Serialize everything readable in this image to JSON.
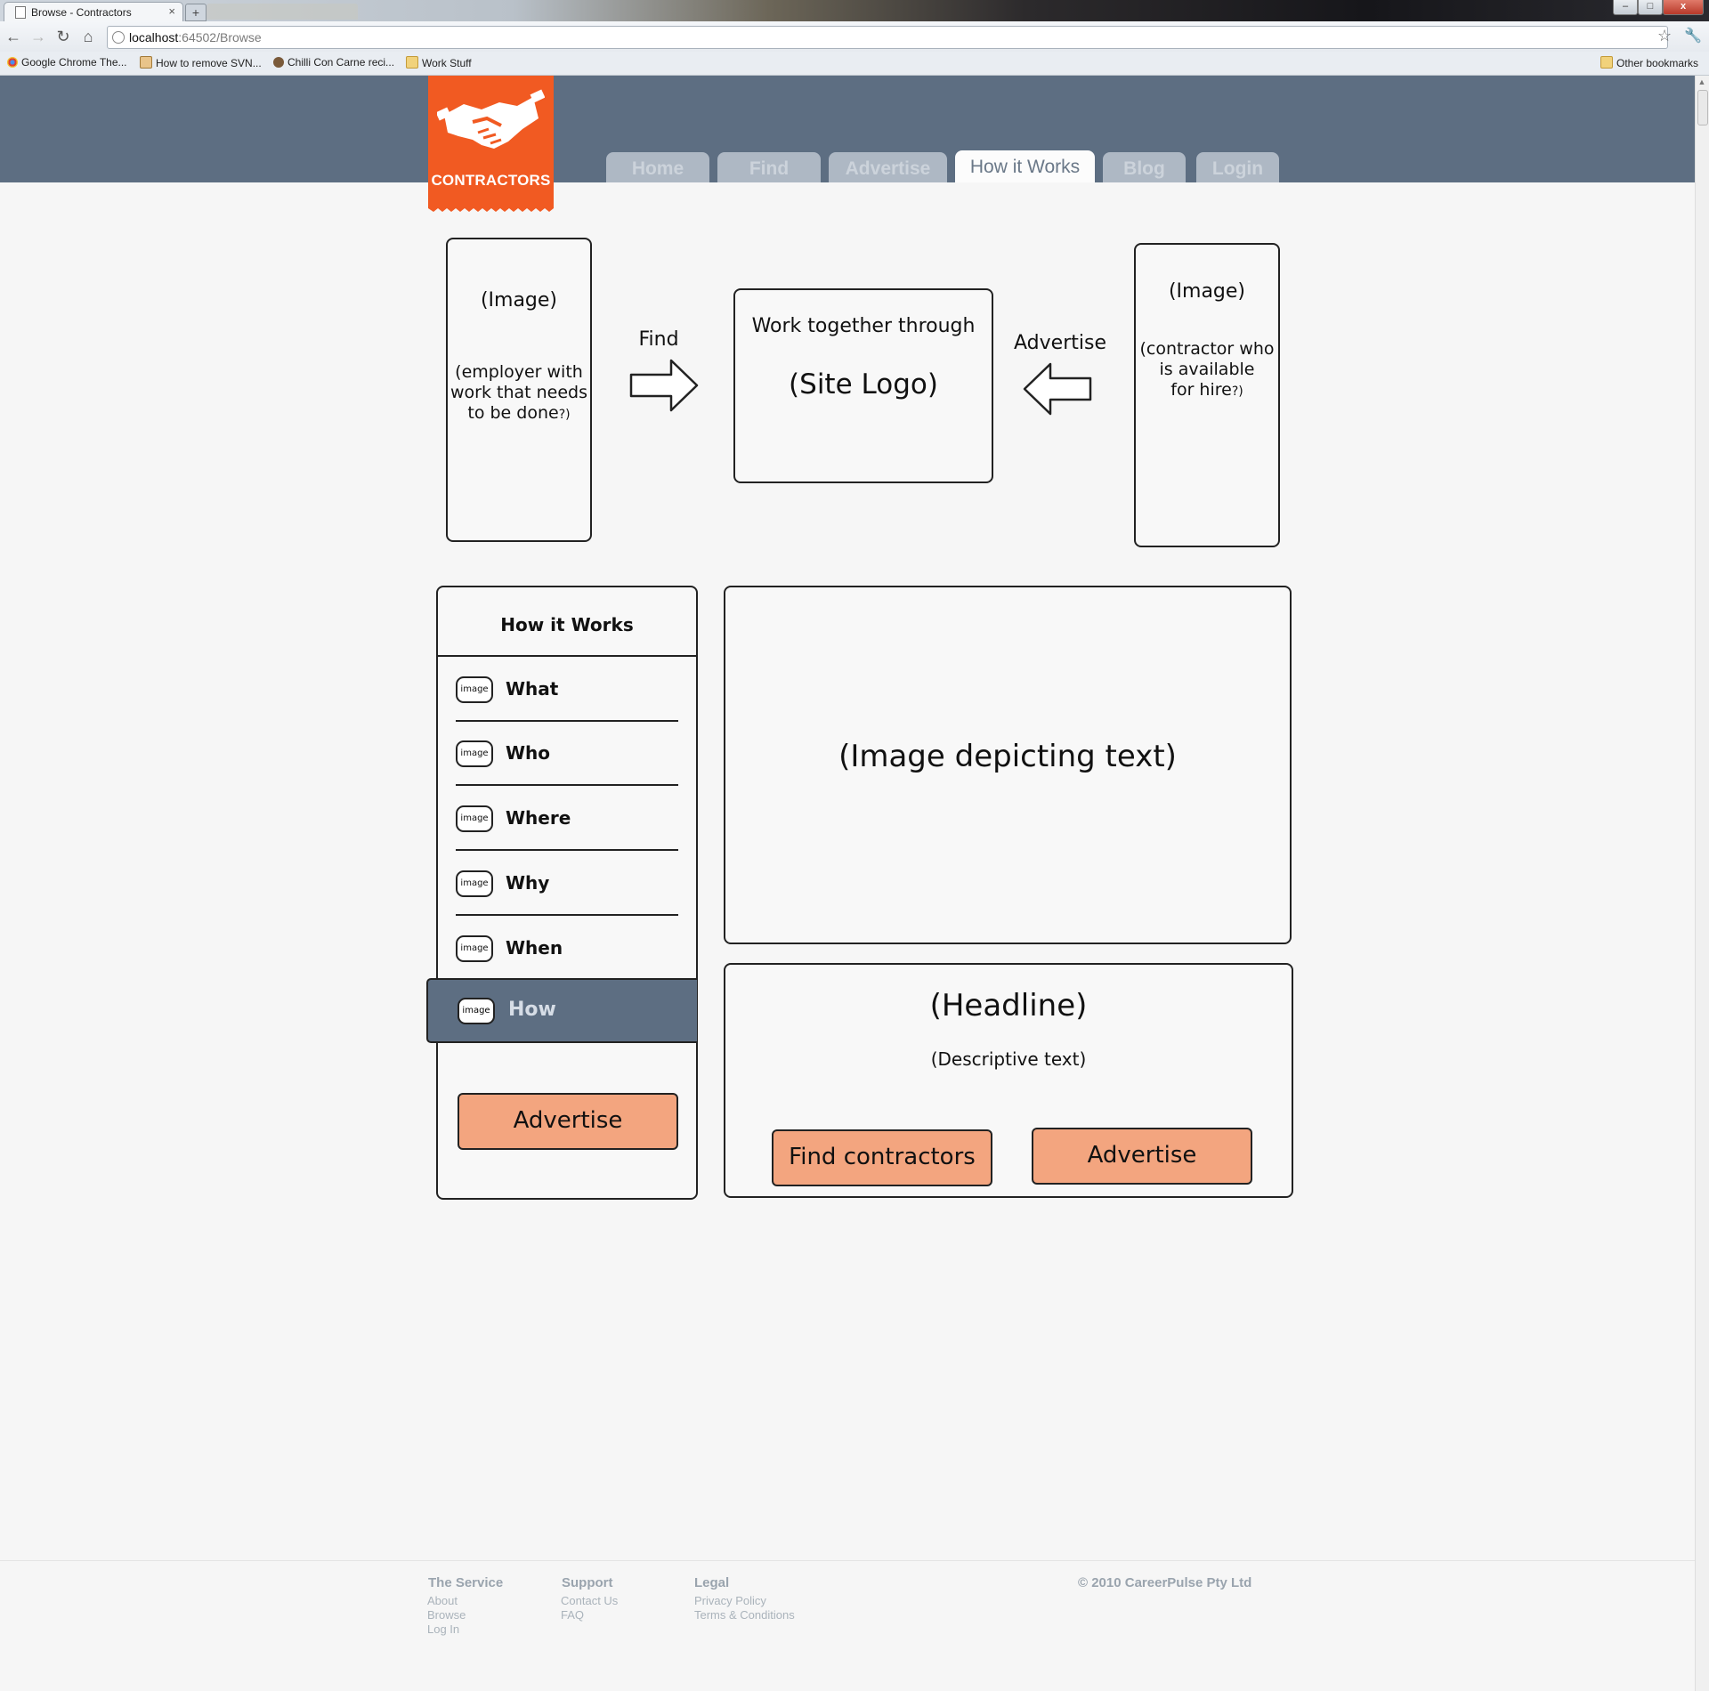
{
  "browser": {
    "tab_title": "Browse - Contractors",
    "url_host": "localhost",
    "url_rest": ":64502/Browse",
    "bookmarks": [
      {
        "label": "Google Chrome The...",
        "icon": "chrome-icon"
      },
      {
        "label": "How to remove SVN...",
        "icon": "page-icon"
      },
      {
        "label": "Chilli Con Carne reci...",
        "icon": "bookmark-icon"
      },
      {
        "label": "Work Stuff",
        "icon": "folder-icon"
      }
    ],
    "other_bookmarks": "Other bookmarks"
  },
  "site": {
    "logo_text": "CONTRACTORS",
    "nav": [
      {
        "label": "Home"
      },
      {
        "label": "Find"
      },
      {
        "label": "Advertise"
      },
      {
        "label": "How it Works",
        "active": true
      },
      {
        "label": "Blog"
      },
      {
        "label": "Login"
      }
    ],
    "colors": {
      "brand": "#f15a22",
      "header": "#5d6e82",
      "button": "#f3a57f"
    }
  },
  "diagram": {
    "left_image": {
      "title": "(Image)",
      "caption_1": "(employer with",
      "caption_2": "work that needs",
      "caption_3": "to be done",
      "caption_end": "?)"
    },
    "find_label": "Find",
    "center": {
      "line1": "Work together through",
      "line2": "(Site Logo)"
    },
    "advertise_label": "Advertise",
    "right_image": {
      "title": "(Image)",
      "caption_1": "(contractor who",
      "caption_2": "is available",
      "caption_3": "for hire",
      "caption_end": "?)"
    }
  },
  "how_it_works": {
    "title": "How it Works",
    "image_placeholder": "image",
    "items": [
      {
        "label": "What"
      },
      {
        "label": "Who"
      },
      {
        "label": "Where"
      },
      {
        "label": "Why"
      },
      {
        "label": "When"
      },
      {
        "label": "How",
        "active": true
      }
    ],
    "advertise_button": "Advertise"
  },
  "main_panel": {
    "image_text": "(Image depicting text)",
    "headline": "(Headline)",
    "description": "(Descriptive text)",
    "find_button": "Find contractors",
    "advertise_button": "Advertise"
  },
  "footer": {
    "columns": [
      {
        "heading": "The Service",
        "links": [
          "About",
          "Browse",
          "Log In"
        ]
      },
      {
        "heading": "Support",
        "links": [
          "Contact Us",
          "FAQ"
        ]
      },
      {
        "heading": "Legal",
        "links": [
          "Privacy Policy",
          "Terms & Conditions"
        ]
      }
    ],
    "copyright": "© 2010 CareerPulse Pty Ltd"
  }
}
